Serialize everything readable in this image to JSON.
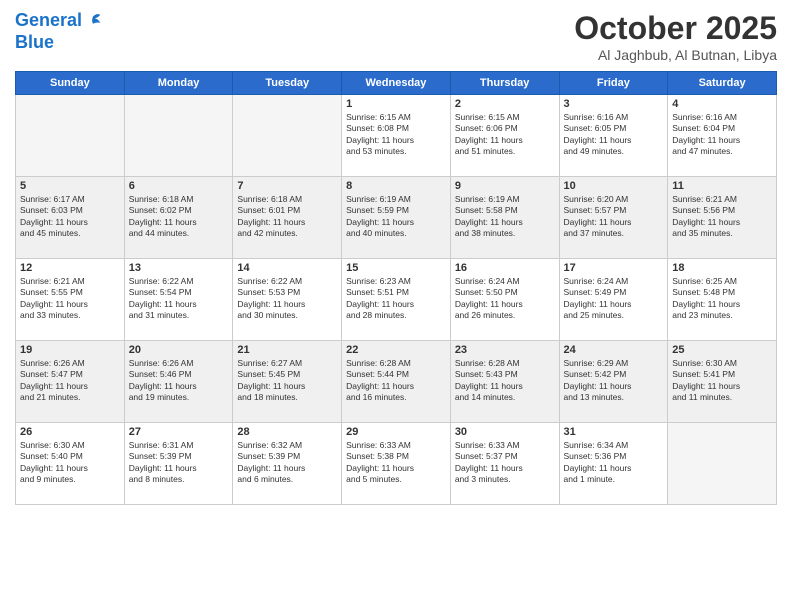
{
  "header": {
    "logo_line1": "General",
    "logo_line2": "Blue",
    "month": "October 2025",
    "location": "Al Jaghbub, Al Butnan, Libya"
  },
  "days_of_week": [
    "Sunday",
    "Monday",
    "Tuesday",
    "Wednesday",
    "Thursday",
    "Friday",
    "Saturday"
  ],
  "weeks": [
    [
      {
        "day": "",
        "info": ""
      },
      {
        "day": "",
        "info": ""
      },
      {
        "day": "",
        "info": ""
      },
      {
        "day": "1",
        "info": "Sunrise: 6:15 AM\nSunset: 6:08 PM\nDaylight: 11 hours\nand 53 minutes."
      },
      {
        "day": "2",
        "info": "Sunrise: 6:15 AM\nSunset: 6:06 PM\nDaylight: 11 hours\nand 51 minutes."
      },
      {
        "day": "3",
        "info": "Sunrise: 6:16 AM\nSunset: 6:05 PM\nDaylight: 11 hours\nand 49 minutes."
      },
      {
        "day": "4",
        "info": "Sunrise: 6:16 AM\nSunset: 6:04 PM\nDaylight: 11 hours\nand 47 minutes."
      }
    ],
    [
      {
        "day": "5",
        "info": "Sunrise: 6:17 AM\nSunset: 6:03 PM\nDaylight: 11 hours\nand 45 minutes."
      },
      {
        "day": "6",
        "info": "Sunrise: 6:18 AM\nSunset: 6:02 PM\nDaylight: 11 hours\nand 44 minutes."
      },
      {
        "day": "7",
        "info": "Sunrise: 6:18 AM\nSunset: 6:01 PM\nDaylight: 11 hours\nand 42 minutes."
      },
      {
        "day": "8",
        "info": "Sunrise: 6:19 AM\nSunset: 5:59 PM\nDaylight: 11 hours\nand 40 minutes."
      },
      {
        "day": "9",
        "info": "Sunrise: 6:19 AM\nSunset: 5:58 PM\nDaylight: 11 hours\nand 38 minutes."
      },
      {
        "day": "10",
        "info": "Sunrise: 6:20 AM\nSunset: 5:57 PM\nDaylight: 11 hours\nand 37 minutes."
      },
      {
        "day": "11",
        "info": "Sunrise: 6:21 AM\nSunset: 5:56 PM\nDaylight: 11 hours\nand 35 minutes."
      }
    ],
    [
      {
        "day": "12",
        "info": "Sunrise: 6:21 AM\nSunset: 5:55 PM\nDaylight: 11 hours\nand 33 minutes."
      },
      {
        "day": "13",
        "info": "Sunrise: 6:22 AM\nSunset: 5:54 PM\nDaylight: 11 hours\nand 31 minutes."
      },
      {
        "day": "14",
        "info": "Sunrise: 6:22 AM\nSunset: 5:53 PM\nDaylight: 11 hours\nand 30 minutes."
      },
      {
        "day": "15",
        "info": "Sunrise: 6:23 AM\nSunset: 5:51 PM\nDaylight: 11 hours\nand 28 minutes."
      },
      {
        "day": "16",
        "info": "Sunrise: 6:24 AM\nSunset: 5:50 PM\nDaylight: 11 hours\nand 26 minutes."
      },
      {
        "day": "17",
        "info": "Sunrise: 6:24 AM\nSunset: 5:49 PM\nDaylight: 11 hours\nand 25 minutes."
      },
      {
        "day": "18",
        "info": "Sunrise: 6:25 AM\nSunset: 5:48 PM\nDaylight: 11 hours\nand 23 minutes."
      }
    ],
    [
      {
        "day": "19",
        "info": "Sunrise: 6:26 AM\nSunset: 5:47 PM\nDaylight: 11 hours\nand 21 minutes."
      },
      {
        "day": "20",
        "info": "Sunrise: 6:26 AM\nSunset: 5:46 PM\nDaylight: 11 hours\nand 19 minutes."
      },
      {
        "day": "21",
        "info": "Sunrise: 6:27 AM\nSunset: 5:45 PM\nDaylight: 11 hours\nand 18 minutes."
      },
      {
        "day": "22",
        "info": "Sunrise: 6:28 AM\nSunset: 5:44 PM\nDaylight: 11 hours\nand 16 minutes."
      },
      {
        "day": "23",
        "info": "Sunrise: 6:28 AM\nSunset: 5:43 PM\nDaylight: 11 hours\nand 14 minutes."
      },
      {
        "day": "24",
        "info": "Sunrise: 6:29 AM\nSunset: 5:42 PM\nDaylight: 11 hours\nand 13 minutes."
      },
      {
        "day": "25",
        "info": "Sunrise: 6:30 AM\nSunset: 5:41 PM\nDaylight: 11 hours\nand 11 minutes."
      }
    ],
    [
      {
        "day": "26",
        "info": "Sunrise: 6:30 AM\nSunset: 5:40 PM\nDaylight: 11 hours\nand 9 minutes."
      },
      {
        "day": "27",
        "info": "Sunrise: 6:31 AM\nSunset: 5:39 PM\nDaylight: 11 hours\nand 8 minutes."
      },
      {
        "day": "28",
        "info": "Sunrise: 6:32 AM\nSunset: 5:39 PM\nDaylight: 11 hours\nand 6 minutes."
      },
      {
        "day": "29",
        "info": "Sunrise: 6:33 AM\nSunset: 5:38 PM\nDaylight: 11 hours\nand 5 minutes."
      },
      {
        "day": "30",
        "info": "Sunrise: 6:33 AM\nSunset: 5:37 PM\nDaylight: 11 hours\nand 3 minutes."
      },
      {
        "day": "31",
        "info": "Sunrise: 6:34 AM\nSunset: 5:36 PM\nDaylight: 11 hours\nand 1 minute."
      },
      {
        "day": "",
        "info": ""
      }
    ]
  ]
}
